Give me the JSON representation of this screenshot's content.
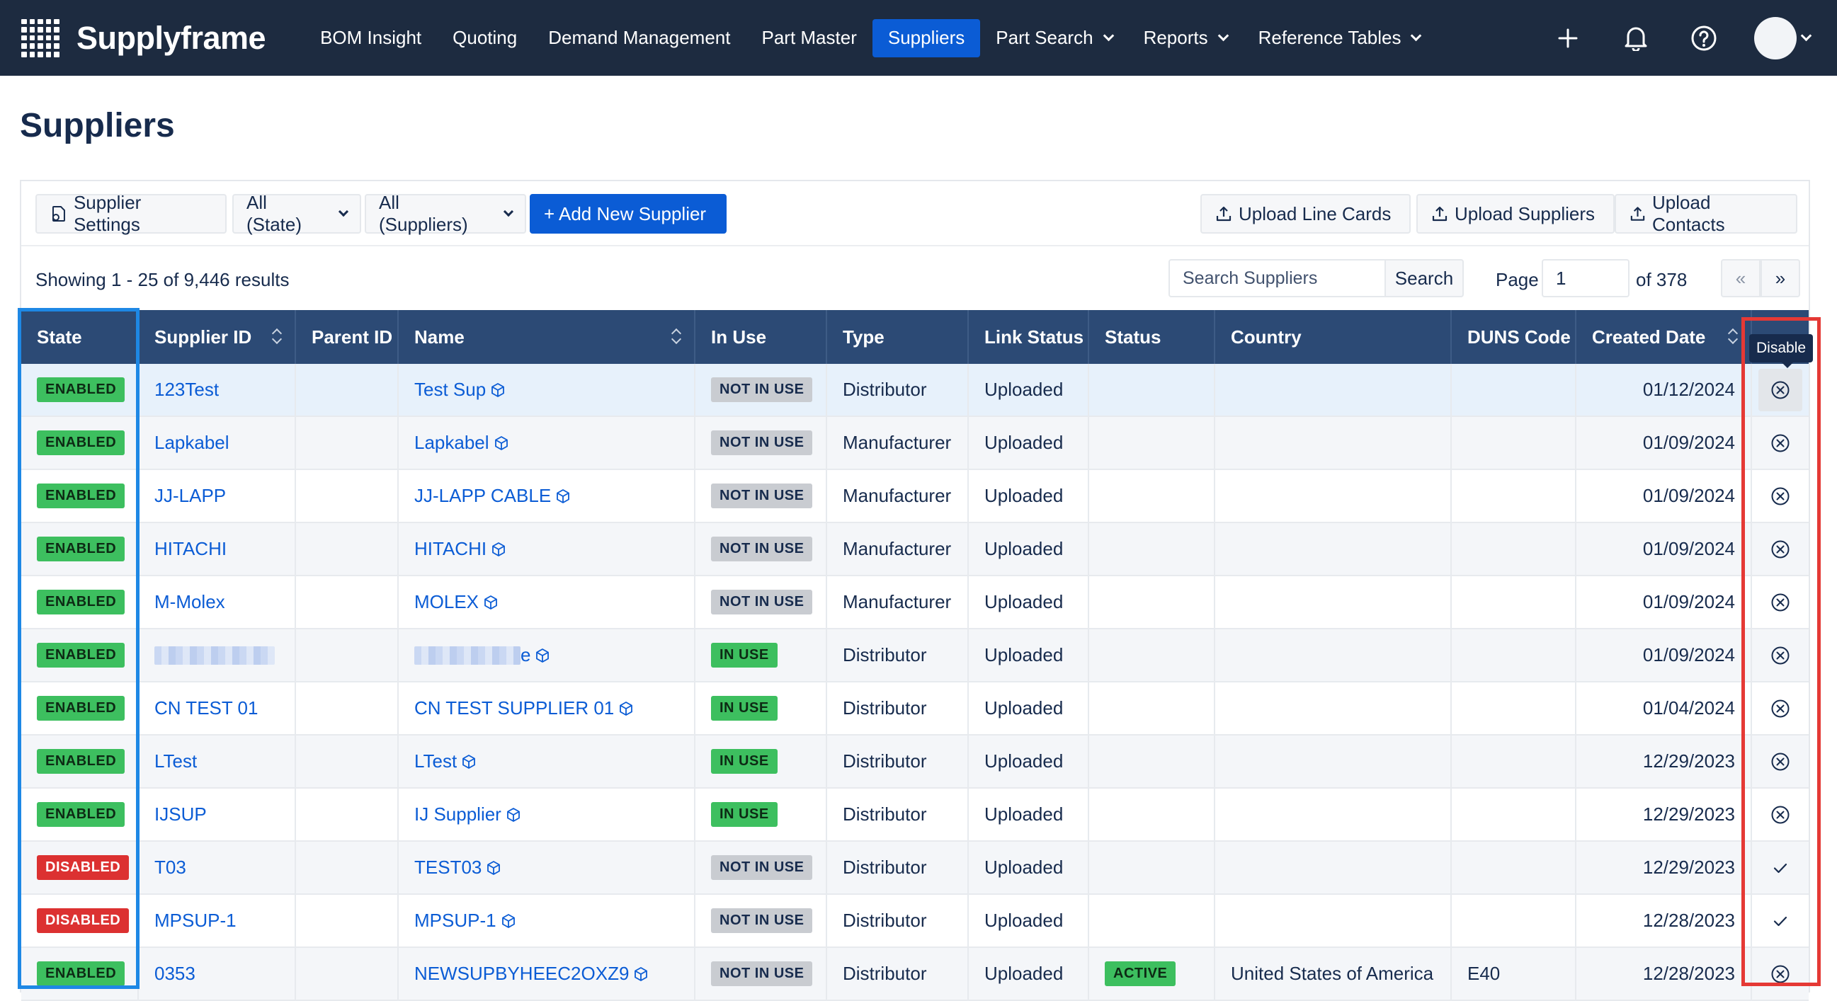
{
  "app": {
    "brand": "Supplyframe",
    "nav": [
      {
        "label": "BOM Insight",
        "dropdown": false,
        "active": false
      },
      {
        "label": "Quoting",
        "dropdown": false,
        "active": false
      },
      {
        "label": "Demand Management",
        "dropdown": false,
        "active": false
      },
      {
        "label": "Part Master",
        "dropdown": false,
        "active": false
      },
      {
        "label": "Suppliers",
        "dropdown": false,
        "active": true
      },
      {
        "label": "Part Search",
        "dropdown": true,
        "active": false
      },
      {
        "label": "Reports",
        "dropdown": true,
        "active": false
      },
      {
        "label": "Reference Tables",
        "dropdown": true,
        "active": false
      }
    ],
    "icons": [
      "plus-icon",
      "bell-icon",
      "help-icon",
      "avatar"
    ]
  },
  "page": {
    "title": "Suppliers"
  },
  "toolbar": {
    "settings_label": "Supplier Settings",
    "state_filter": "All (State)",
    "supplier_filter": "All (Suppliers)",
    "add_label": "+ Add New Supplier",
    "upload_line_cards": "Upload Line Cards",
    "upload_suppliers": "Upload Suppliers",
    "upload_contacts": "Upload Contacts"
  },
  "listing": {
    "results_text": "Showing 1 - 25 of 9,446 results",
    "search_placeholder": "Search Suppliers",
    "search_button": "Search",
    "page_label": "Page",
    "page_value": "1",
    "page_of": "of 378",
    "prev": "«",
    "next": "»"
  },
  "table": {
    "columns": [
      "State",
      "Supplier ID",
      "Parent ID",
      "Name",
      "In Use",
      "Type",
      "Link Status",
      "Status",
      "Country",
      "DUNS Code",
      "Created Date",
      ""
    ],
    "tooltip": "Disable",
    "rows": [
      {
        "state": "ENABLED",
        "supplier_id": "123Test",
        "parent_id": "",
        "name": "Test Sup",
        "in_use": "NOT IN USE",
        "type": "Distributor",
        "link_status": "Uploaded",
        "status": "",
        "country": "",
        "duns": "",
        "created": "01/12/2024",
        "action": "disable"
      },
      {
        "state": "ENABLED",
        "supplier_id": "Lapkabel",
        "parent_id": "",
        "name": "Lapkabel",
        "in_use": "NOT IN USE",
        "type": "Manufacturer",
        "link_status": "Uploaded",
        "status": "",
        "country": "",
        "duns": "",
        "created": "01/09/2024",
        "action": "disable"
      },
      {
        "state": "ENABLED",
        "supplier_id": "JJ-LAPP",
        "parent_id": "",
        "name": "JJ-LAPP CABLE",
        "in_use": "NOT IN USE",
        "type": "Manufacturer",
        "link_status": "Uploaded",
        "status": "",
        "country": "",
        "duns": "",
        "created": "01/09/2024",
        "action": "disable"
      },
      {
        "state": "ENABLED",
        "supplier_id": "HITACHI",
        "parent_id": "",
        "name": "HITACHI",
        "in_use": "NOT IN USE",
        "type": "Manufacturer",
        "link_status": "Uploaded",
        "status": "",
        "country": "",
        "duns": "",
        "created": "01/09/2024",
        "action": "disable"
      },
      {
        "state": "ENABLED",
        "supplier_id": "M-Molex",
        "parent_id": "",
        "name": "MOLEX",
        "in_use": "NOT IN USE",
        "type": "Manufacturer",
        "link_status": "Uploaded",
        "status": "",
        "country": "",
        "duns": "",
        "created": "01/09/2024",
        "action": "disable"
      },
      {
        "state": "ENABLED",
        "supplier_id": "",
        "parent_id": "",
        "name": "e",
        "in_use": "IN USE",
        "type": "Distributor",
        "link_status": "Uploaded",
        "status": "",
        "country": "",
        "duns": "",
        "created": "01/09/2024",
        "action": "disable"
      },
      {
        "state": "ENABLED",
        "supplier_id": "CN TEST 01",
        "parent_id": "",
        "name": "CN TEST SUPPLIER 01",
        "in_use": "IN USE",
        "type": "Distributor",
        "link_status": "Uploaded",
        "status": "",
        "country": "",
        "duns": "",
        "created": "01/04/2024",
        "action": "disable"
      },
      {
        "state": "ENABLED",
        "supplier_id": "LTest",
        "parent_id": "",
        "name": "LTest",
        "in_use": "IN USE",
        "type": "Distributor",
        "link_status": "Uploaded",
        "status": "",
        "country": "",
        "duns": "",
        "created": "12/29/2023",
        "action": "disable"
      },
      {
        "state": "ENABLED",
        "supplier_id": "IJSUP",
        "parent_id": "",
        "name": "IJ Supplier",
        "in_use": "IN USE",
        "type": "Distributor",
        "link_status": "Uploaded",
        "status": "",
        "country": "",
        "duns": "",
        "created": "12/29/2023",
        "action": "disable"
      },
      {
        "state": "DISABLED",
        "supplier_id": "T03",
        "parent_id": "",
        "name": "TEST03",
        "in_use": "NOT IN USE",
        "type": "Distributor",
        "link_status": "Uploaded",
        "status": "",
        "country": "",
        "duns": "",
        "created": "12/29/2023",
        "action": "enable"
      },
      {
        "state": "DISABLED",
        "supplier_id": "MPSUP-1",
        "parent_id": "",
        "name": "MPSUP-1",
        "in_use": "NOT IN USE",
        "type": "Distributor",
        "link_status": "Uploaded",
        "status": "",
        "country": "",
        "duns": "",
        "created": "12/28/2023",
        "action": "enable"
      },
      {
        "state": "ENABLED",
        "supplier_id": "0353",
        "parent_id": "",
        "name": "NEWSUPBYHEEC2OXZ9",
        "in_use": "NOT IN USE",
        "type": "Distributor",
        "link_status": "Uploaded",
        "status": "ACTIVE",
        "country": "United States of America",
        "duns": "E40",
        "created": "12/28/2023",
        "action": "disable"
      }
    ]
  },
  "colors": {
    "nav_bg": "#1d2b40",
    "accent": "#0b5cd5",
    "header_bg": "#2c4a75",
    "enabled": "#3dbf5f",
    "disabled": "#dc3131",
    "highlight_blue": "#1e88e5",
    "highlight_red": "#e53935"
  }
}
